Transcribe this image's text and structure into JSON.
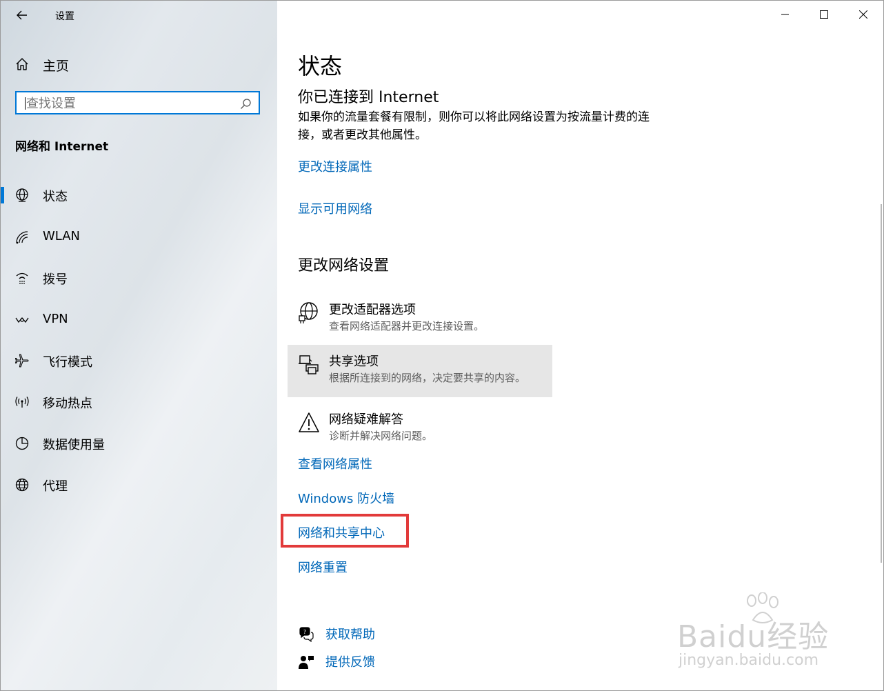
{
  "window": {
    "title": "设置"
  },
  "sidebar": {
    "home_label": "主页",
    "search_placeholder": "查找设置",
    "section_title": "网络和 Internet",
    "items": [
      {
        "label": "状态",
        "icon": "globe-status-icon",
        "active": true
      },
      {
        "label": "WLAN",
        "icon": "wifi-icon",
        "active": false
      },
      {
        "label": "拨号",
        "icon": "dialup-icon",
        "active": false
      },
      {
        "label": "VPN",
        "icon": "vpn-icon",
        "active": false
      },
      {
        "label": "飞行模式",
        "icon": "airplane-icon",
        "active": false
      },
      {
        "label": "移动热点",
        "icon": "hotspot-icon",
        "active": false
      },
      {
        "label": "数据使用量",
        "icon": "data-usage-icon",
        "active": false
      },
      {
        "label": "代理",
        "icon": "proxy-globe-icon",
        "active": false
      }
    ]
  },
  "main": {
    "page_title": "状态",
    "connected_heading": "你已连接到 Internet",
    "connected_desc": "如果你的流量套餐有限制，则你可以将此网络设置为按流量计费的连接，或者更改其他属性。",
    "link_change_props": "更改连接属性",
    "link_show_networks": "显示可用网络",
    "change_settings_heading": "更改网络设置",
    "options": [
      {
        "title": "更改适配器选项",
        "subtitle": "查看网络适配器并更改连接设置。",
        "icon": "adapter-icon"
      },
      {
        "title": "共享选项",
        "subtitle": "根据所连接到的网络，决定要共享的内容。",
        "icon": "sharing-icon"
      },
      {
        "title": "网络疑难解答",
        "subtitle": "诊断并解决网络问题。",
        "icon": "warning-icon"
      }
    ],
    "link_view_props": "查看网络属性",
    "link_firewall": "Windows 防火墙",
    "link_sharing_center": "网络和共享中心",
    "link_reset": "网络重置",
    "help_label": "获取帮助",
    "feedback_label": "提供反馈"
  },
  "watermark": {
    "brand": "Baidu经验",
    "url": "jingyan.baidu.com"
  },
  "colors": {
    "accent": "#0078d7",
    "link": "#0067b8",
    "highlight_box": "#e23a3a"
  }
}
